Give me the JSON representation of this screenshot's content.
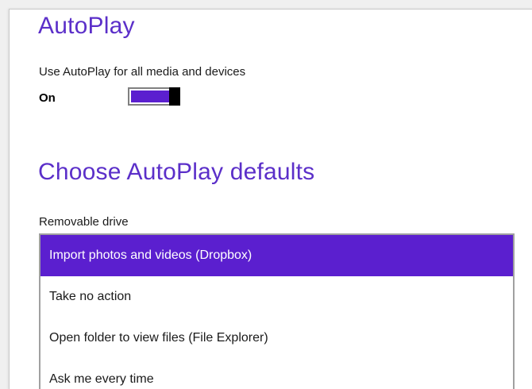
{
  "autoplay": {
    "title": "AutoPlay",
    "use_label": "Use AutoPlay for all media and devices",
    "toggle": {
      "state_label": "On",
      "is_on": true,
      "accent_color": "#5b1fcf"
    }
  },
  "defaults": {
    "title": "Choose AutoPlay defaults",
    "removable_drive": {
      "label": "Removable drive",
      "options": [
        {
          "label": "Import photos and videos (Dropbox)",
          "selected": true
        },
        {
          "label": "Take no action",
          "selected": false
        },
        {
          "label": "Open folder to view files (File Explorer)",
          "selected": false
        },
        {
          "label": "Ask me every time",
          "selected": false
        }
      ]
    }
  },
  "colors": {
    "heading": "#5b2fc9",
    "selection": "#5b1fcf"
  }
}
